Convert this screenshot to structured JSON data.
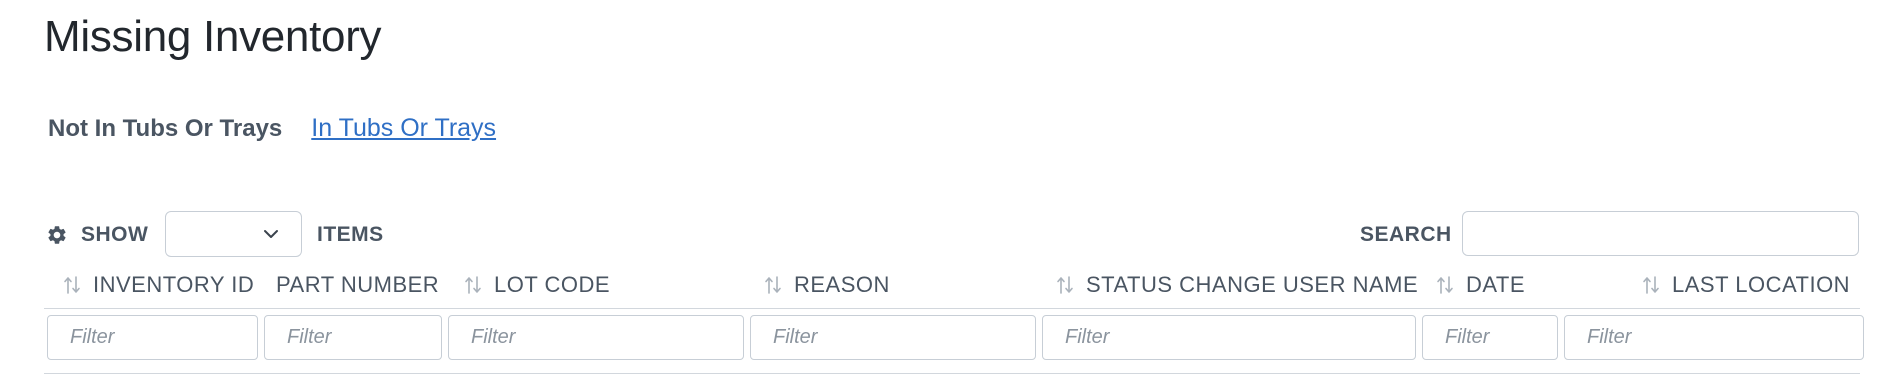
{
  "page": {
    "title": "Missing Inventory"
  },
  "subnav": {
    "current": "Not In Tubs Or Trays",
    "link": "In Tubs Or Trays"
  },
  "toolbar": {
    "settings_icon": "gear-icon",
    "show_label": "SHOW",
    "page_size_value": "",
    "items_label": "ITEMS",
    "search_label": "SEARCH",
    "search_value": ""
  },
  "table": {
    "columns": [
      {
        "label": "INVENTORY ID",
        "sortable": true
      },
      {
        "label": "PART NUMBER",
        "sortable": false
      },
      {
        "label": "LOT CODE",
        "sortable": true
      },
      {
        "label": "REASON",
        "sortable": true
      },
      {
        "label": "STATUS CHANGE USER NAME",
        "sortable": true
      },
      {
        "label": "DATE",
        "sortable": true
      },
      {
        "label": "LAST LOCATION",
        "sortable": true
      }
    ],
    "filter_placeholder": "Filter"
  },
  "colors": {
    "link": "#2f6fc5",
    "text": "#4a5562",
    "border": "#c7ced6"
  }
}
